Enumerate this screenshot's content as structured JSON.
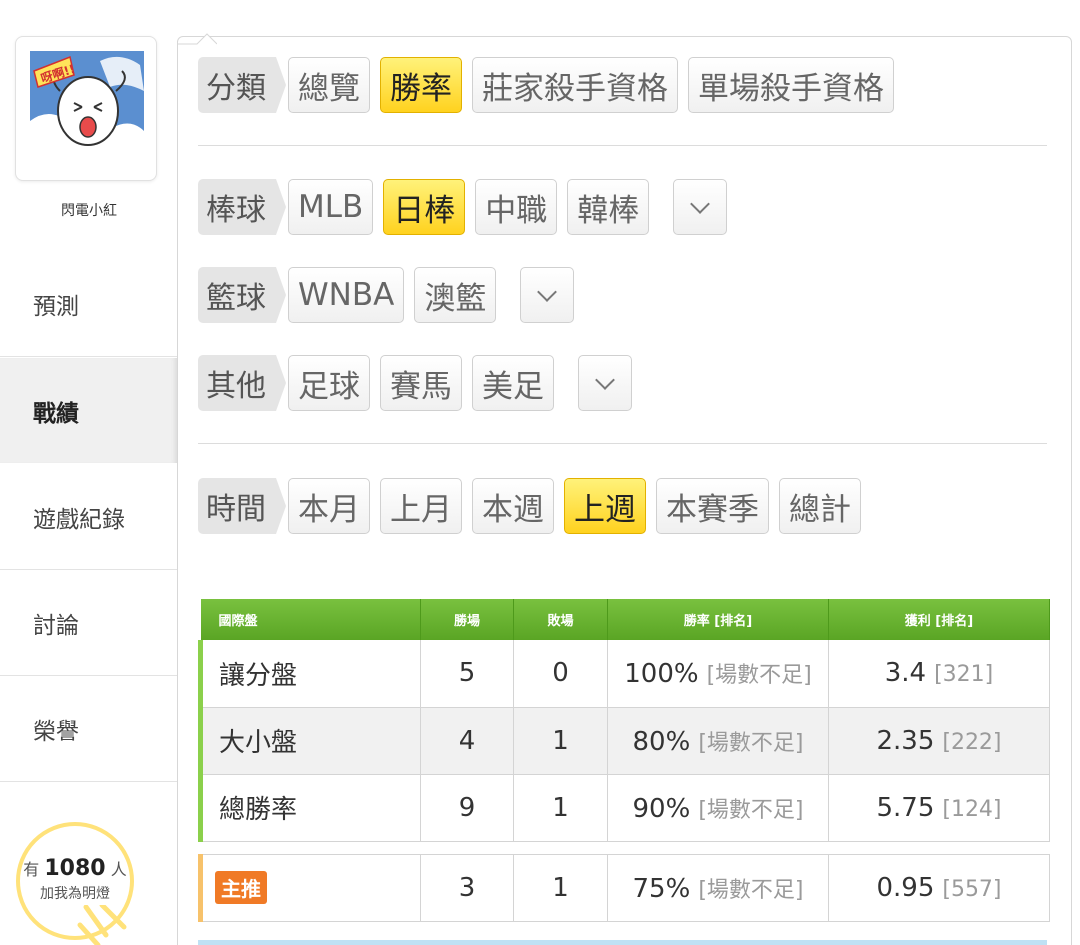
{
  "user": {
    "name": "閃電小紅"
  },
  "nav": [
    {
      "label": "預測",
      "active": false
    },
    {
      "label": "戰績",
      "active": true
    },
    {
      "label": "遊戲紀錄",
      "active": false
    },
    {
      "label": "討論",
      "active": false
    },
    {
      "label": "榮譽",
      "active": false
    }
  ],
  "fans": {
    "prefix": "有",
    "count": "1080",
    "suffix": "人",
    "action": "加我為明燈"
  },
  "filters": {
    "category": {
      "label": "分類",
      "options": [
        "總覽",
        "勝率",
        "莊家殺手資格",
        "單場殺手資格"
      ],
      "selected": "勝率"
    },
    "baseball": {
      "label": "棒球",
      "options": [
        "MLB",
        "日棒",
        "中職",
        "韓棒"
      ],
      "selected": "日棒"
    },
    "basketball": {
      "label": "籃球",
      "options": [
        "WNBA",
        "澳籃"
      ]
    },
    "other": {
      "label": "其他",
      "options": [
        "足球",
        "賽馬",
        "美足"
      ]
    },
    "time": {
      "label": "時間",
      "options": [
        "本月",
        "上月",
        "本週",
        "上週",
        "本賽季",
        "總計"
      ],
      "selected": "上週"
    }
  },
  "table": {
    "headers": [
      "國際盤",
      "勝場",
      "敗場",
      "勝率 [排名]",
      "獲利 [排名]"
    ],
    "rows": [
      {
        "type": "讓分盤",
        "wins": "5",
        "losses": "0",
        "rate": "100%",
        "rate_rank": "[場數不足]",
        "profit": "3.4",
        "profit_rank": "[321]"
      },
      {
        "type": "大小盤",
        "wins": "4",
        "losses": "1",
        "rate": "80%",
        "rate_rank": "[場數不足]",
        "profit": "2.35",
        "profit_rank": "[222]"
      },
      {
        "type": "總勝率",
        "wins": "9",
        "losses": "1",
        "rate": "90%",
        "rate_rank": "[場數不足]",
        "profit": "5.75",
        "profit_rank": "[124]"
      }
    ],
    "recommend": {
      "badge": "主推",
      "wins": "3",
      "losses": "1",
      "rate": "75%",
      "rate_rank": "[場數不足]",
      "profit": "0.95",
      "profit_rank": "[557]"
    }
  },
  "colors": {
    "accent_yellow": "#ffd21f",
    "header_green": "#5aa524",
    "badge_orange": "#f07a26"
  }
}
